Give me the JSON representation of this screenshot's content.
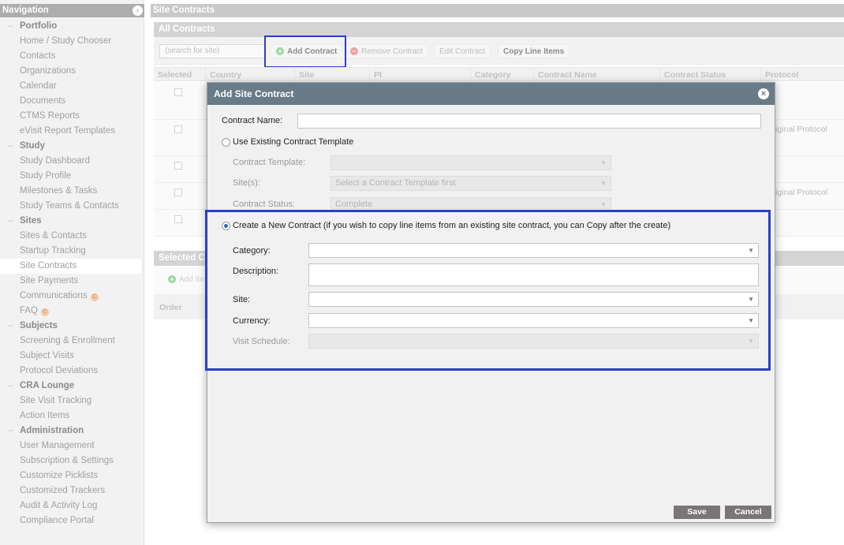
{
  "sidebar": {
    "title": "Navigation",
    "collapse_icon": "chevron-left-icon",
    "items": [
      {
        "label": "Portfolio",
        "type": "section"
      },
      {
        "label": "Home / Study Chooser",
        "type": "item"
      },
      {
        "label": "Contacts",
        "type": "item"
      },
      {
        "label": "Organizations",
        "type": "item"
      },
      {
        "label": "Calendar",
        "type": "item"
      },
      {
        "label": "Documents",
        "type": "item"
      },
      {
        "label": "CTMS Reports",
        "type": "item"
      },
      {
        "label": "eVisit Report Templates",
        "type": "item"
      },
      {
        "label": "Study",
        "type": "section"
      },
      {
        "label": "Study Dashboard",
        "type": "item"
      },
      {
        "label": "Study Profile",
        "type": "item"
      },
      {
        "label": "Milestones & Tasks",
        "type": "item"
      },
      {
        "label": "Study Teams & Contacts",
        "type": "item"
      },
      {
        "label": "Sites",
        "type": "section"
      },
      {
        "label": "Sites & Contacts",
        "type": "item"
      },
      {
        "label": "Startup Tracking",
        "type": "item"
      },
      {
        "label": "Site Contracts",
        "type": "item",
        "active": true
      },
      {
        "label": "Site Payments",
        "type": "item"
      },
      {
        "label": "Communications",
        "type": "item",
        "badge": "C"
      },
      {
        "label": "FAQ",
        "type": "item",
        "badge": "C"
      },
      {
        "label": "Subjects",
        "type": "section"
      },
      {
        "label": "Screening & Enrollment",
        "type": "item"
      },
      {
        "label": "Subject Visits",
        "type": "item"
      },
      {
        "label": "Protocol Deviations",
        "type": "item"
      },
      {
        "label": "CRA Lounge",
        "type": "section"
      },
      {
        "label": "Site Visit Tracking",
        "type": "item"
      },
      {
        "label": "Action Items",
        "type": "item"
      },
      {
        "label": "Administration",
        "type": "section"
      },
      {
        "label": "User Management",
        "type": "item"
      },
      {
        "label": "Subscription & Settings",
        "type": "item"
      },
      {
        "label": "Customize Picklists",
        "type": "item"
      },
      {
        "label": "Customized Trackers",
        "type": "item"
      },
      {
        "label": "Audit & Activity Log",
        "type": "item"
      },
      {
        "label": "Compliance Portal",
        "type": "item"
      }
    ]
  },
  "main": {
    "title": "Site Contracts",
    "panel_title": "All Contracts",
    "search_placeholder": "(search for site)",
    "toolbar": {
      "add_contract": "Add Contract",
      "remove_contract": "Remove Contract",
      "edit_contract": "Edit Contract",
      "copy_line_items": "Copy Line Items"
    },
    "columns": [
      "Selected",
      "Country",
      "Site",
      "PI",
      "Category",
      "Contract Name",
      "Contract Status",
      "Protocol"
    ],
    "rows": [
      {
        "protocol": ""
      },
      {
        "protocol": "iginal Protocol"
      },
      {
        "protocol": ""
      },
      {
        "protocol": "iginal Protocol"
      },
      {
        "protocol": ""
      }
    ],
    "selected_panel_title": "Selected C",
    "selected_add": "Add Ite",
    "selected_columns": [
      "Order"
    ]
  },
  "modal": {
    "title": "Add Site Contract",
    "close_icon": "close-icon",
    "contract_name_label": "Contract Name:",
    "contract_name_value": "",
    "use_template_label": "Use Existing Contract Template",
    "use_template_selected": false,
    "template_label": "Contract Template:",
    "template_value": "",
    "sites_label": "Site(s):",
    "sites_value": "Select a Contract Template first",
    "status_label": "Contract Status:",
    "status_value": "Complete",
    "create_new_label": "Create a New Contract (if you wish to copy line items from an existing site contract, you can Copy after the create)",
    "create_new_selected": true,
    "category_label": "Category:",
    "category_value": "",
    "description_label": "Description:",
    "description_value": "",
    "site_label": "Site:",
    "site_value": "",
    "currency_label": "Currency:",
    "currency_value": "",
    "visit_schedule_label": "Visit Schedule:",
    "visit_schedule_value": "",
    "save_label": "Save",
    "cancel_label": "Cancel"
  },
  "colors": {
    "modal_title_bar": "#687b86",
    "highlight_border": "#2a3fc8",
    "button_bg": "#7a7577",
    "radio_selected": "#2a67c8"
  }
}
